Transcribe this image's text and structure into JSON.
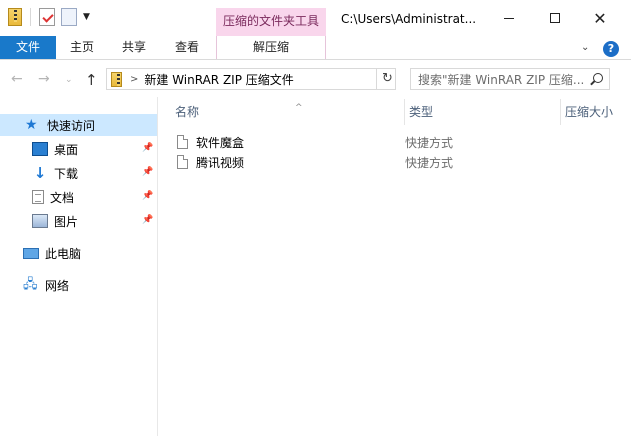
{
  "window": {
    "title": "C:\\Users\\Administrat...",
    "contextual_tab_group": "压缩的文件夹工具"
  },
  "ribbon": {
    "tabs": [
      {
        "label": "文件"
      },
      {
        "label": "主页"
      },
      {
        "label": "共享"
      },
      {
        "label": "查看"
      },
      {
        "label": "解压缩"
      }
    ],
    "help": "?"
  },
  "address_bar": {
    "path": "新建 WinRAR ZIP 压缩文件",
    "search_placeholder": "搜索\"新建 WinRAR ZIP 压缩..."
  },
  "nav_pane": {
    "quick_access": "快速访问",
    "items": [
      {
        "label": "桌面",
        "pinned": true
      },
      {
        "label": "下载",
        "pinned": true
      },
      {
        "label": "文档",
        "pinned": true
      },
      {
        "label": "图片",
        "pinned": true
      }
    ],
    "this_pc": "此电脑",
    "network": "网络"
  },
  "file_list": {
    "columns": [
      "名称",
      "类型",
      "压缩大小"
    ],
    "rows": [
      {
        "name": "软件魔盒",
        "type": "快捷方式"
      },
      {
        "name": "腾讯视频",
        "type": "快捷方式"
      }
    ]
  },
  "colors": {
    "file_tab": "#1979ca",
    "contextual_tab": "#f9d6ec",
    "selection": "#cce8ff"
  }
}
